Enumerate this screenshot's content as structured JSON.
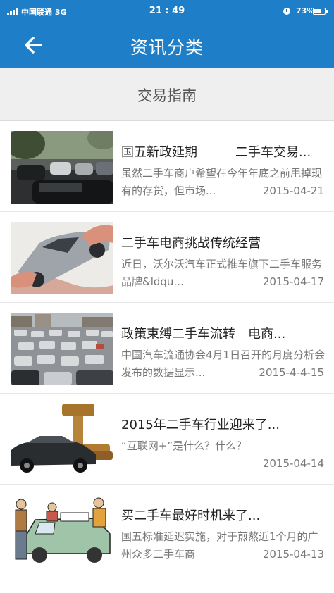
{
  "status_bar": {
    "carrier": "中国联通 3G",
    "time": "21 : 49",
    "battery": "73%",
    "battery_level": 0.73
  },
  "nav": {
    "title": "资讯分类",
    "back_icon": "arrow-left-icon"
  },
  "category": {
    "label": "交易指南"
  },
  "news": [
    {
      "headline": "国五新政延期　　　二手车交易...",
      "summary": "虽然二手车商户希望在今年年底之前甩掉现有的存货，但市场...",
      "date": "2015-04-21",
      "thumb": "traffic-street-photo"
    },
    {
      "headline": "二手车电商挑战传统经营",
      "summary": "近日，沃尔沃汽车正式推车旗下二手车服务品牌&ldqu...",
      "date": "2015-04-17",
      "thumb": "hand-holding-car-photo"
    },
    {
      "headline": "政策束缚二手车流转　电商...",
      "summary": "中国汽车流通协会4月1日召开的月度分析会发布的数据显示...",
      "date": "2015-4-4-15",
      "thumb": "car-lot-photo"
    },
    {
      "headline": "2015年二手车行业迎来了...",
      "summary": "“互联网+”是什么？什么？",
      "date": "2015-04-14",
      "thumb": "gavel-and-car-photo"
    },
    {
      "headline": "买二手车最好时机来了...",
      "summary": "国五标准延迟实施，对于煎熬近1个月的广州众多二手车商",
      "date": "2015-04-13",
      "thumb": "used-car-cartoon"
    }
  ]
}
